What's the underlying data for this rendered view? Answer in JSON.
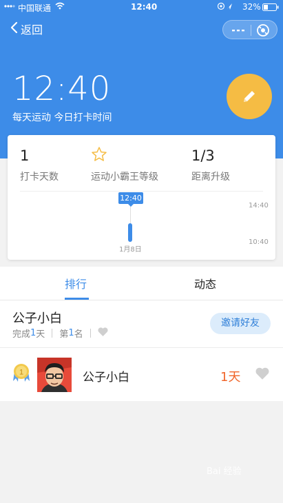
{
  "status_bar": {
    "carrier": "中国联通",
    "time": "12:40",
    "battery": "32%"
  },
  "nav": {
    "back_label": "返回"
  },
  "header": {
    "checkin_time": "12:40",
    "subtitle": "每天运动 今日打卡时间"
  },
  "stats": [
    {
      "value": "1",
      "label": "打卡天数"
    },
    {
      "value": "",
      "label": "运动小霸王等级",
      "icon": "star-outline-icon"
    },
    {
      "value": "1/3",
      "label": "距离升级"
    }
  ],
  "timeline": {
    "tag": "12:40",
    "date": "1月8日",
    "time_top": "14:40",
    "time_bottom": "10:40"
  },
  "tabs": [
    {
      "label": "排行",
      "active": true
    },
    {
      "label": "动态",
      "active": false
    }
  ],
  "me": {
    "name": "公子小白",
    "done_prefix": "完成",
    "done_count": "1",
    "done_suffix": "天",
    "rank_prefix": "第",
    "rank_num": "1",
    "rank_suffix": "名"
  },
  "invite_label": "邀请好友",
  "ranking": [
    {
      "rank": "1",
      "name": "公子小白",
      "days": "1天"
    }
  ],
  "colors": {
    "primary": "#3d8ce8",
    "accent_orange": "#f5bc44",
    "days_orange": "#f0652a"
  },
  "watermark": "Bai 经验"
}
